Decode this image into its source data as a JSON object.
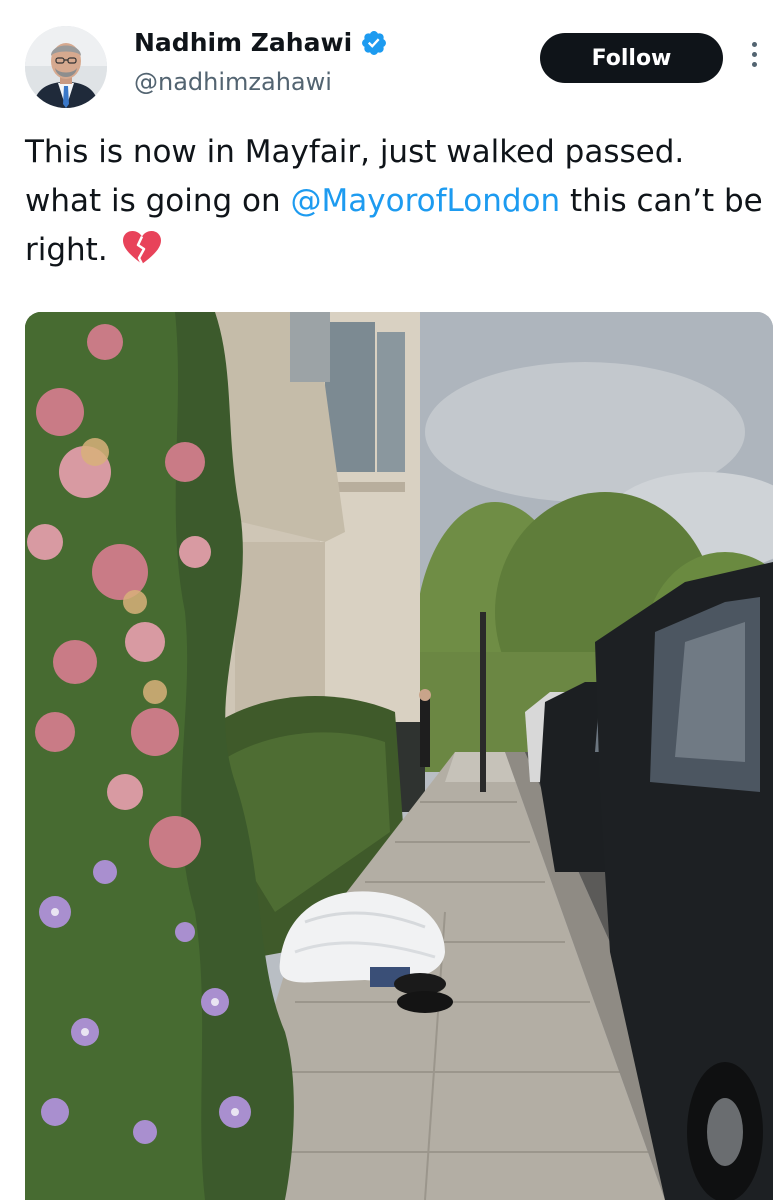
{
  "author": {
    "name": "Nadhim Zahawi",
    "handle": "@nadhimzahawi",
    "verified": true,
    "avatar_icon": "profile-photo-avatar"
  },
  "actions": {
    "follow_label": "Follow",
    "more_icon": "more-vertical-icon"
  },
  "tweet": {
    "text_part1": "This is now in Mayfair, just walked passed. what is going on ",
    "mention": "@MayorofLondon",
    "text_part2": " this can’t be right. ",
    "emoji": "broken-heart-icon"
  },
  "media": {
    "photo_icon": "street-photo"
  },
  "colors": {
    "accent": "#1d9bf0",
    "follow_bg": "#0f1419",
    "secondary_text": "#536471",
    "broken_heart": "#e8435a"
  }
}
